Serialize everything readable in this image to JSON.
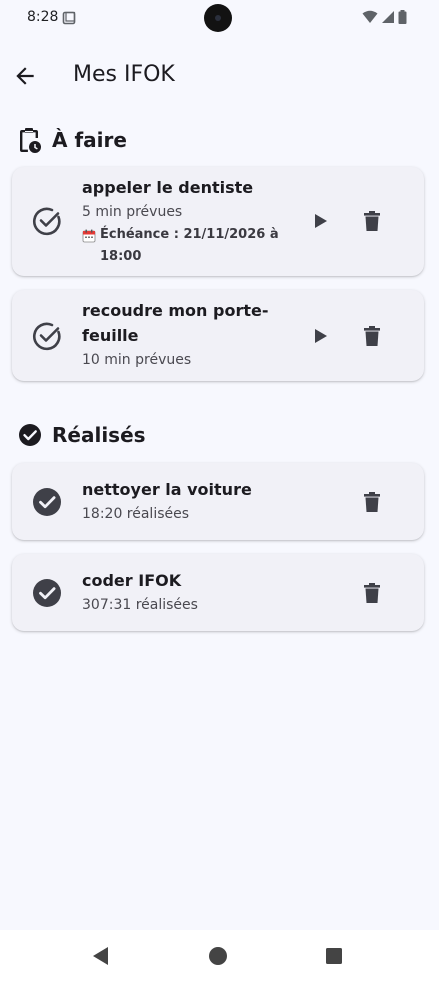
{
  "status": {
    "time": "8:28"
  },
  "app_bar": {
    "title": "Mes IFOK"
  },
  "todo_section": {
    "title": "À faire",
    "items": [
      {
        "title": "appeler le dentiste",
        "meta": "5 min prévues",
        "due": "Échéance : 21/11/2026 à 18:00"
      },
      {
        "title": "recoudre mon porte-feuille",
        "meta": "10 min prévues"
      }
    ]
  },
  "done_section": {
    "title": "Réalisés",
    "items": [
      {
        "title": "nettoyer la voiture",
        "meta": "18:20 réalisées"
      },
      {
        "title": "coder IFOK",
        "meta": "307:31 réalisées"
      }
    ]
  },
  "colors": {
    "background": "#f7f8fe",
    "card": "#f1f1f7",
    "icon": "#3f4048"
  }
}
